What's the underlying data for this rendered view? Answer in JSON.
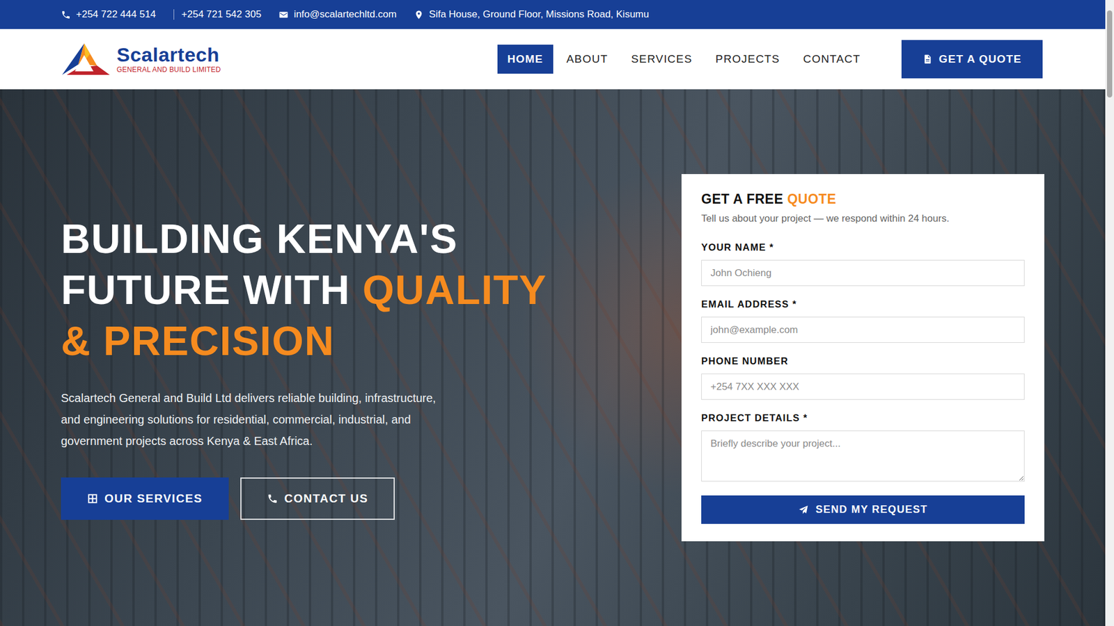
{
  "topbar": {
    "items": [
      {
        "text": "+254 722 444 514",
        "kind": "phone"
      },
      {
        "text": "+254 721 542 305",
        "kind": "separator"
      },
      {
        "text": "info@scalartechltd.com",
        "kind": "email"
      },
      {
        "text": "Sifa House, Ground Floor, Missions Road, Kisumu",
        "kind": "location"
      }
    ]
  },
  "logo": {
    "name": "Scalartech",
    "tagline": "GENERAL AND BUILD LIMITED"
  },
  "nav": {
    "items": [
      {
        "label": "HOME",
        "selected": true
      },
      {
        "label": "ABOUT",
        "selected": false
      },
      {
        "label": "SERVICES",
        "selected": false
      },
      {
        "label": "PROJECTS",
        "selected": false
      },
      {
        "label": "CONTACT",
        "selected": false
      }
    ],
    "cta": "GET A QUOTE"
  },
  "hero": {
    "title_lines": [
      [
        {
          "text": "BUILDING KENYA'S",
          "highlight": false
        }
      ],
      [
        {
          "text": "FUTURE WITH ",
          "highlight": false
        },
        {
          "text": "QUALITY",
          "highlight": true
        }
      ],
      [
        {
          "text": "& PRECISION",
          "highlight": true
        }
      ]
    ],
    "description": "Scalartech General and Build Ltd delivers reliable building, infrastructure, and engineering solutions for residential, commercial, industrial, and government projects across Kenya & East Africa.",
    "buttons": [
      {
        "label": "OUR SERVICES",
        "kind": "primary"
      },
      {
        "label": "CONTACT US",
        "kind": "outline"
      }
    ]
  },
  "quote_form": {
    "title": "GET A FREE",
    "title_accent": "QUOTE",
    "subtitle": "Tell us about your project — we respond within 24 hours.",
    "fields": [
      {
        "label": "YOUR NAME *",
        "placeholder": "John Ochieng",
        "kind": "input"
      },
      {
        "label": "EMAIL ADDRESS *",
        "placeholder": "john@example.com",
        "kind": "input"
      },
      {
        "label": "PHONE NUMBER",
        "placeholder": "+254 7XX XXX XXX",
        "kind": "input"
      },
      {
        "label": "PROJECT DETAILS *",
        "placeholder": "Briefly describe your project...",
        "kind": "textarea"
      }
    ],
    "submit": "SEND MY REQUEST"
  }
}
